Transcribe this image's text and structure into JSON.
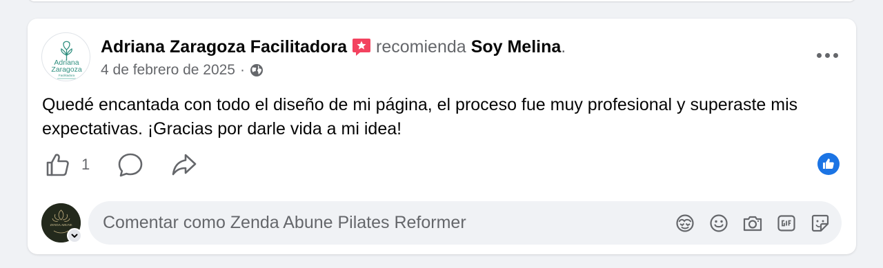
{
  "post": {
    "author": "Adriana Zaragoza Facilitadora",
    "recommend_word": "recomienda",
    "page_name": "Soy Melina",
    "period": ".",
    "date": "4 de febrero de 2025",
    "date_separator": "·",
    "audience_icon": "globe-icon",
    "text": "Quedé encantada con todo el diseño de mi página, el proceso fue muy profesional y superaste mis expectativas. ¡Gracias por darle vida a mi idea!",
    "avatar_logo": {
      "line1": "Adriana",
      "line2": "Zaragoza",
      "line3": "Facilitadora"
    }
  },
  "actions": {
    "like_count": "1",
    "like_icon": "thumbs-up-icon",
    "comment_icon": "comment-icon",
    "share_icon": "share-icon",
    "reaction_icon": "like-reaction-icon"
  },
  "composer": {
    "placeholder": "Comentar como Zenda Abune Pilates Reformer",
    "avatar_text": "ZENDA ABUNE",
    "icons": [
      "avatar-sticker-icon",
      "emoji-icon",
      "camera-icon",
      "gif-icon",
      "sticker-icon"
    ]
  },
  "colors": {
    "background": "#f0f2f5",
    "accent_blue": "#1b74e4",
    "secondary_text": "#65676b",
    "recommend_badge": "#f3425f",
    "logo_green": "#2f8f7f"
  }
}
